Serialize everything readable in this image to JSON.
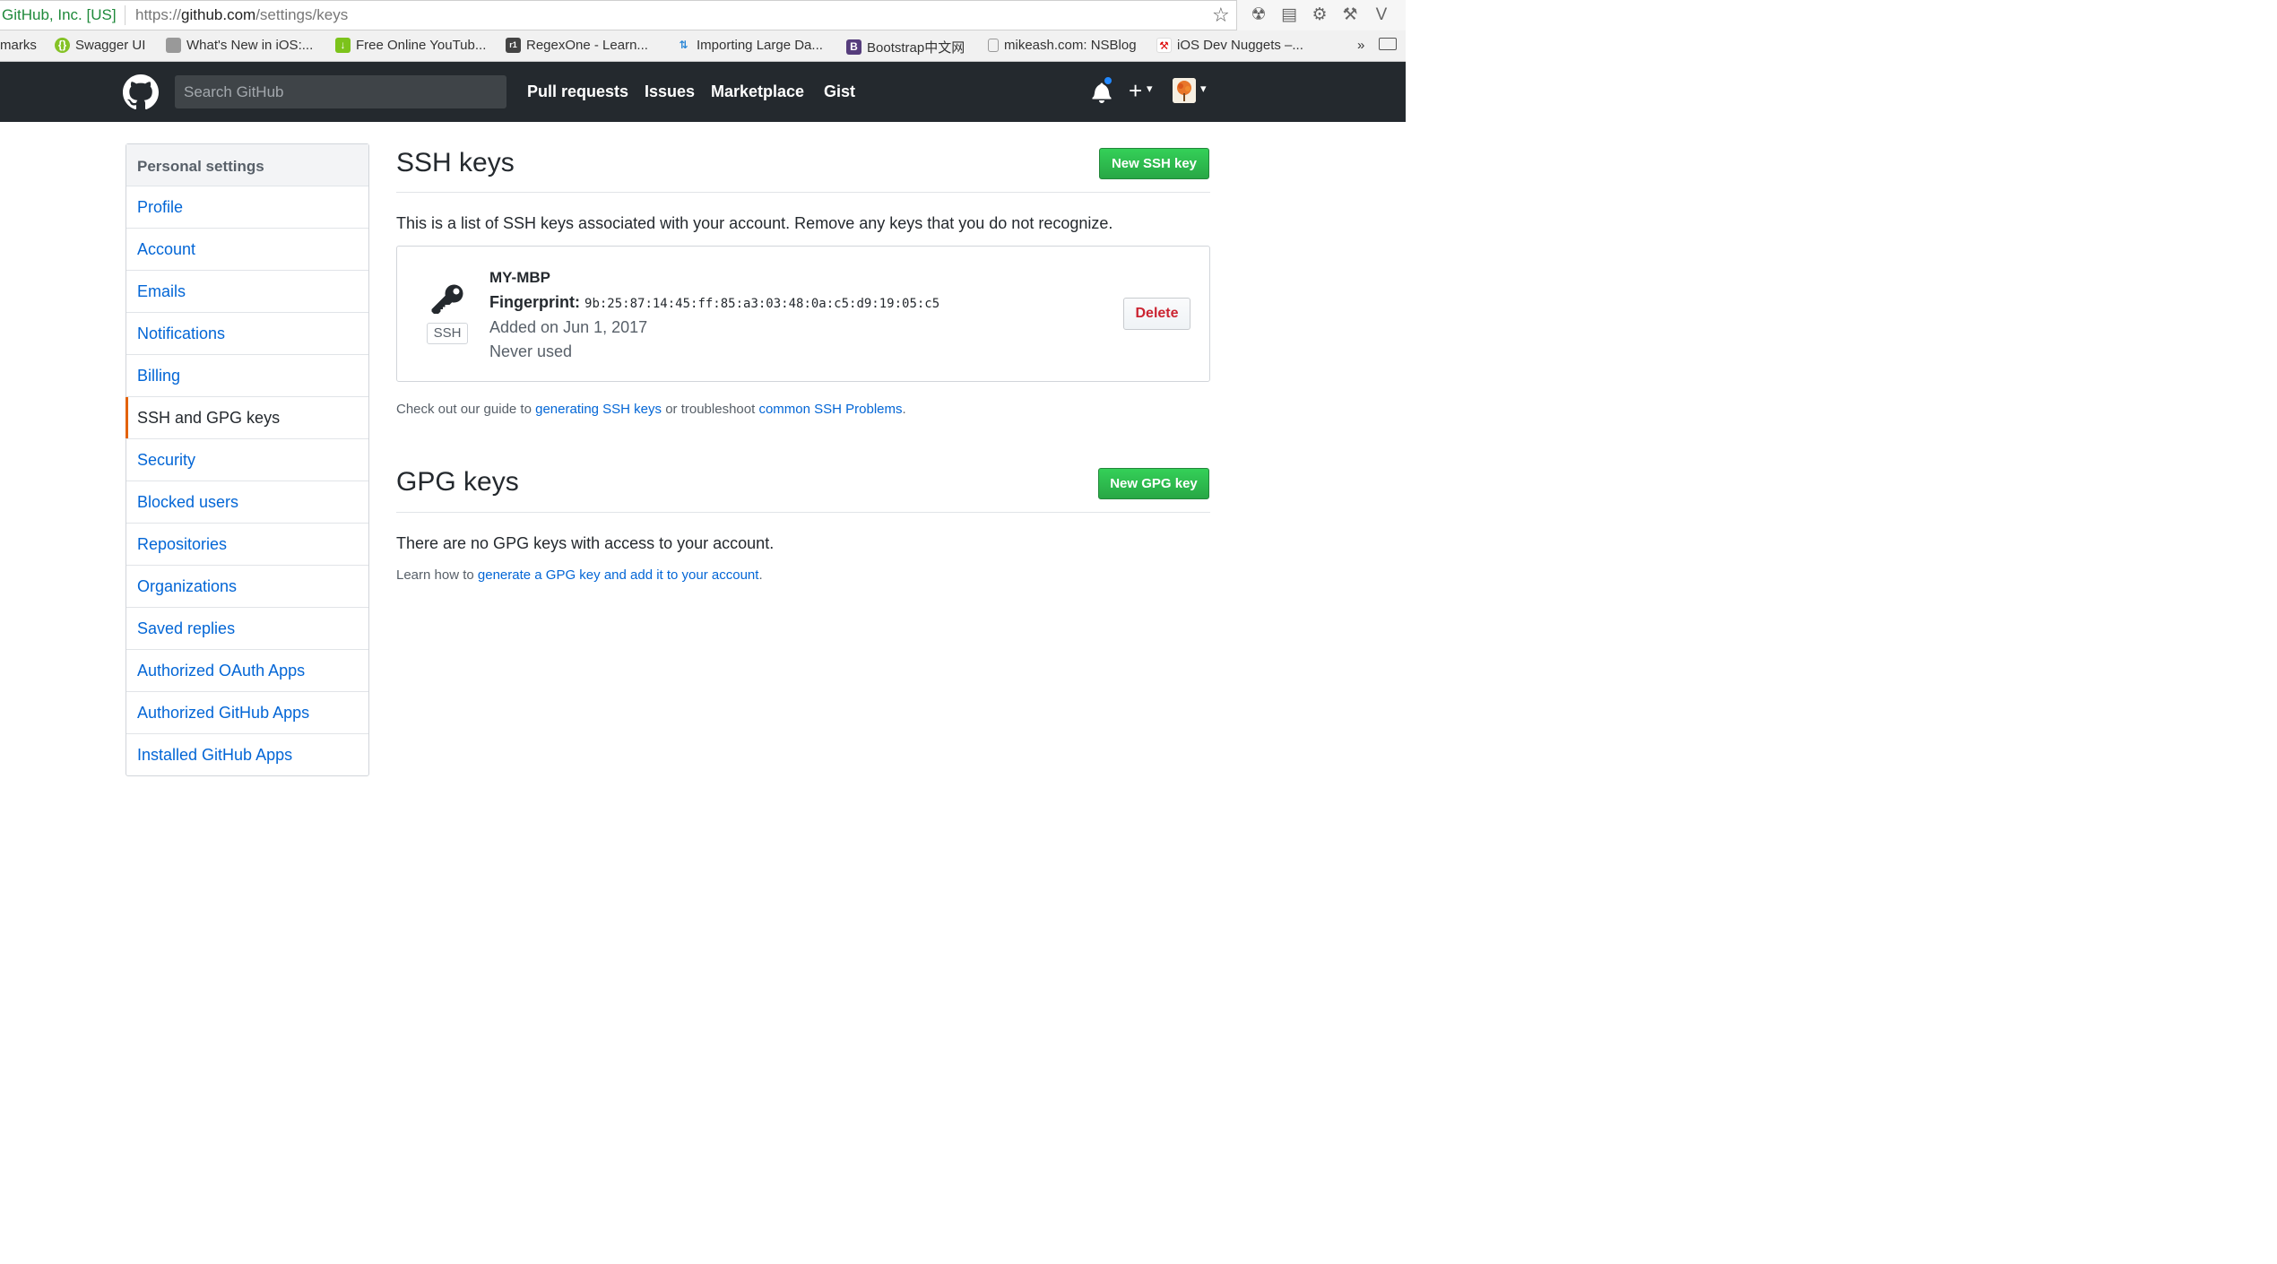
{
  "browser": {
    "site_identity": "GitHub, Inc. [US]",
    "url_scheme": "https://",
    "url_host": "github.com",
    "url_path": "/settings/keys",
    "bookmarks": [
      "marks",
      "Swagger UI",
      "What's New in iOS:...",
      "Free Online YouTub...",
      "RegexOne - Learn...",
      "Importing Large Da...",
      "Bootstrap中文网",
      "mikeash.com: NSBlog",
      "iOS Dev Nuggets –..."
    ],
    "overflow": "»"
  },
  "header": {
    "search_placeholder": "Search GitHub",
    "nav": [
      "Pull requests",
      "Issues",
      "Marketplace",
      "Gist"
    ],
    "plus_symbol": "+",
    "caret": "▾"
  },
  "sidebar": {
    "heading": "Personal settings",
    "items": [
      "Profile",
      "Account",
      "Emails",
      "Notifications",
      "Billing",
      "SSH and GPG keys",
      "Security",
      "Blocked users",
      "Repositories",
      "Organizations",
      "Saved replies",
      "Authorized OAuth Apps",
      "Authorized GitHub Apps",
      "Installed GitHub Apps"
    ],
    "active_item": "SSH and GPG keys"
  },
  "ssh": {
    "title": "SSH keys",
    "new_button": "New SSH key",
    "description": "This is a list of SSH keys associated with your account. Remove any keys that you do not recognize.",
    "key": {
      "label": "SSH",
      "name": "MY-MBP",
      "fingerprint_label": "Fingerprint:",
      "fingerprint": "9b:25:87:14:45:ff:85:a3:03:48:0a:c5:d9:19:05:c5",
      "added": "Added on Jun 1, 2017",
      "usage": "Never used",
      "delete_button": "Delete"
    },
    "guide": {
      "prefix": "Check out our guide to ",
      "link1": "generating SSH keys",
      "middle": " or troubleshoot ",
      "link2": "common SSH Problems",
      "suffix": "."
    }
  },
  "gpg": {
    "title": "GPG keys",
    "new_button": "New GPG key",
    "empty_message": "There are no GPG keys with access to your account.",
    "learn": {
      "prefix": "Learn how to ",
      "link": "generate a GPG key and add it to your account",
      "suffix": "."
    }
  },
  "colors": {
    "header_bg": "#24292e",
    "link": "#0366d6",
    "primary_button": "#28a745",
    "danger": "#cb2431",
    "active_marker": "#e36209",
    "notification_dot": "#2188ff"
  }
}
